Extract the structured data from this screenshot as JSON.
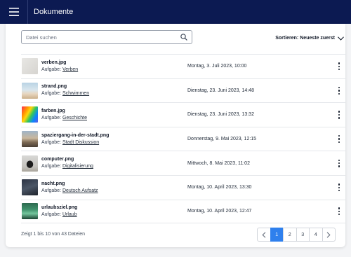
{
  "header": {
    "title": "Dokumente",
    "menu_icon": "hamburger-icon"
  },
  "search": {
    "placeholder": "Datei suchen",
    "value": ""
  },
  "sort": {
    "label": "Sortieren: Neueste zuerst"
  },
  "files": [
    {
      "name": "verben.jpg",
      "task_prefix": "Aufgabe: ",
      "task": "Verben",
      "date": "Montag, 3. Juli 2023, 10:00"
    },
    {
      "name": "strand.png",
      "task_prefix": "Aufgabe: ",
      "task": "Schwimmen",
      "date": "Dienstag, 23. Juni 2023, 14:48"
    },
    {
      "name": "farben.jpg",
      "task_prefix": "Aufgabe: ",
      "task": "Geschichte",
      "date": "Dienstag, 23. Juni 2023, 13:32"
    },
    {
      "name": "spaziergang-in-der-stadt.png",
      "task_prefix": "Aufgabe: ",
      "task": "Stadt Diskussion",
      "date": "Donnerstag, 9. Mai 2023, 12:15"
    },
    {
      "name": "computer.png",
      "task_prefix": "Aufgabe: ",
      "task": "Digitalisierung",
      "date": "Mittwoch, 8. Mai 2023, 11:02"
    },
    {
      "name": "nacht.png",
      "task_prefix": "Aufgabe: ",
      "task": "Deutsch Aufsatz",
      "date": "Montag, 10. April 2023, 13:30"
    },
    {
      "name": "urlaubsziel.png",
      "task_prefix": "Aufgabe: ",
      "task": "Urlaub",
      "date": "Montag, 10. April 2023, 12:47"
    }
  ],
  "footer": {
    "summary": "Zeigt 1 bis 10 von 43 Dateien"
  },
  "pagination": {
    "prev_icon": "chevron-left-icon",
    "next_icon": "chevron-right-icon",
    "pages": [
      "1",
      "2",
      "3",
      "4"
    ],
    "current": "1"
  },
  "colors": {
    "header_bg": "#0c1a52",
    "accent": "#2f80ed"
  }
}
